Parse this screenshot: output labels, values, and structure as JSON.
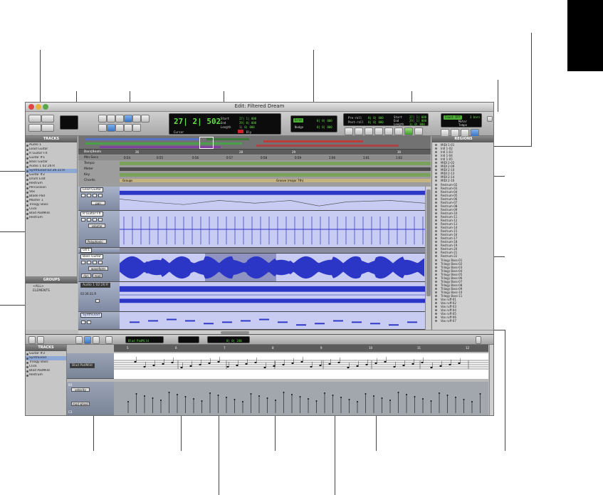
{
  "window": {
    "title": "Edit: Filtered Dream"
  },
  "counter": {
    "main": "27| 2| 502",
    "mode_label": "Cursor",
    "start_label": "Start",
    "end_label": "End",
    "length_label": "Length",
    "start_value": "27| 1| 000",
    "end_value": "29| 0| 000",
    "length_value": "1| 0| 000",
    "dly_label": "Dly"
  },
  "grid_nudge": {
    "grid_label": "Grid",
    "grid_value": "0| 0| 000",
    "nudge_label": "Nudge",
    "nudge_value": "0| 0| 000"
  },
  "preroll": {
    "preroll_label": "Pre-roll",
    "postroll_label": "Post-roll",
    "preroll_value": "0| 0| 000",
    "postroll_value": "0| 0| 000",
    "start_label": "Start",
    "end_label": "End",
    "length_label": "Length",
    "start_value": "27| 1| 000",
    "end_value": "29| 1| 000",
    "length_value": "1| 0| 000"
  },
  "meter": {
    "count_off": "Count Off",
    "meter_label": "Meter",
    "meter_value": "3 bars",
    "tempo_label": "Tempo"
  },
  "tracks_panel": {
    "title": "TRACKS",
    "items": [
      {
        "name": "Audio 1"
      },
      {
        "name": "Lead Guitar"
      },
      {
        "name": "R Guitar FX"
      },
      {
        "name": "Guitar #1"
      },
      {
        "name": "Bass Guitar"
      },
      {
        "name": "Audio 1",
        "time_a": "02:26:R",
        "time_b": "02:26:31:R"
      },
      {
        "name": "SynthLead"
      },
      {
        "name": "Guitar #2"
      },
      {
        "name": "Drum Edit"
      },
      {
        "name": "Restrum"
      },
      {
        "name": "Percussion"
      },
      {
        "name": "Vox"
      },
      {
        "name": "Blade Pad"
      },
      {
        "name": "Master 1"
      },
      {
        "name": "Trilogy Bass"
      },
      {
        "name": "Click"
      },
      {
        "name": "Blad PadMild"
      },
      {
        "name": "Restrum"
      }
    ]
  },
  "groups_panel": {
    "title": "GROUPS",
    "items": [
      "<ALL>",
      "ELEMENTS"
    ]
  },
  "rulers": {
    "bars_beats": "Bars|Beats",
    "min_secs": "Min:Secs",
    "tempo": "Tempo",
    "meter": "Meter",
    "key": "Key",
    "chords": "Chords",
    "bar_numbers": [
      "26",
      "",
      "28",
      "29",
      "",
      "30",
      "31",
      "32"
    ],
    "time_numbers": [
      "0:54",
      "0:55",
      "0:56",
      "0:57",
      "0:58",
      "0:59",
      "1:00",
      "1:01",
      "1:02"
    ],
    "chord_marker": "Groups",
    "key_marker": "Groove (major 7th)"
  },
  "edit_tracks": [
    {
      "name": "Lead Guitar",
      "mode": "pan"
    },
    {
      "name": "R Guitar FX",
      "mode": "volume",
      "plugin": "Polyphonic"
    },
    {
      "name": "Gtr1",
      "mode": ""
    },
    {
      "name": "Bass Guitar",
      "mode": "waveform",
      "sub": "dyn",
      "sub2": "read"
    },
    {
      "name": "Audio 1",
      "time_a": "02:26:R",
      "time_b": "02:26:31:R"
    },
    {
      "name": "SynthLead",
      "mode": ""
    }
  ],
  "regions_panel": {
    "title": "REGIONS",
    "items": [
      "MIDI 1-01",
      "Intl 1-02",
      "Intl 1-03",
      "Intl 1-04",
      "Intl 1-05",
      "MIDI 2-02",
      "MIDI 2-09",
      "MIDI 2-10",
      "MIDI 2-13",
      "MIDI 2-14",
      "MIDI 2-16",
      "Restrum-02",
      "Restrum-03",
      "Restrum-04",
      "Restrum-05",
      "Restrum-06",
      "Restrum-07",
      "Restrum-08",
      "Restrum-09",
      "Restrum-10",
      "Restrum-11",
      "Restrum-12",
      "Restrum-13",
      "Restrum-14",
      "Restrum-15",
      "Restrum-16",
      "Restrum-17",
      "Restrum-18",
      "Restrum-19",
      "Restrum-20",
      "Restrum-21",
      "Restrum-22",
      "Trilogy Bass-01",
      "Trilogy Bass-02",
      "Trilogy Bass-03",
      "Trilogy Bass-04",
      "Trilogy Bass-05",
      "Trilogy Bass-06",
      "Trilogy Bass-07",
      "Trilogy Bass-08",
      "Trilogy Bass-09",
      "Trilogy Bass-10",
      "Trilogy Bass-11",
      "Vox ruff-01",
      "Vox ruff-02",
      "Vox ruff-03",
      "Vox ruff-04",
      "Vox ruff-05",
      "Vox ruff-06",
      "Vox ruff-07"
    ]
  },
  "midi_editor": {
    "instrument": "Blad PadMild",
    "grid_value": "0| 0| 240",
    "tracks_title": "TRACKS",
    "track_list": [
      "Guitar #3",
      "SynthLead",
      "Trilogy Bass",
      "Click",
      "Blad PadMild",
      "Restrum"
    ],
    "notation_label": "Blad PadMild",
    "bar_numbers": [
      "5",
      "6",
      "7",
      "8",
      "9",
      "10",
      "11",
      "12"
    ],
    "lane_labels": [
      "velocity",
      "mod wheel"
    ],
    "mode_labels": [
      "B3",
      "C3"
    ]
  },
  "colors": {
    "lcd_bg": "#0c0c0c",
    "lcd_text": "#63e045",
    "waveform_blue": "#2b35c6",
    "selection": "#8ea8d6",
    "ruler_green": "#7aa25c"
  }
}
